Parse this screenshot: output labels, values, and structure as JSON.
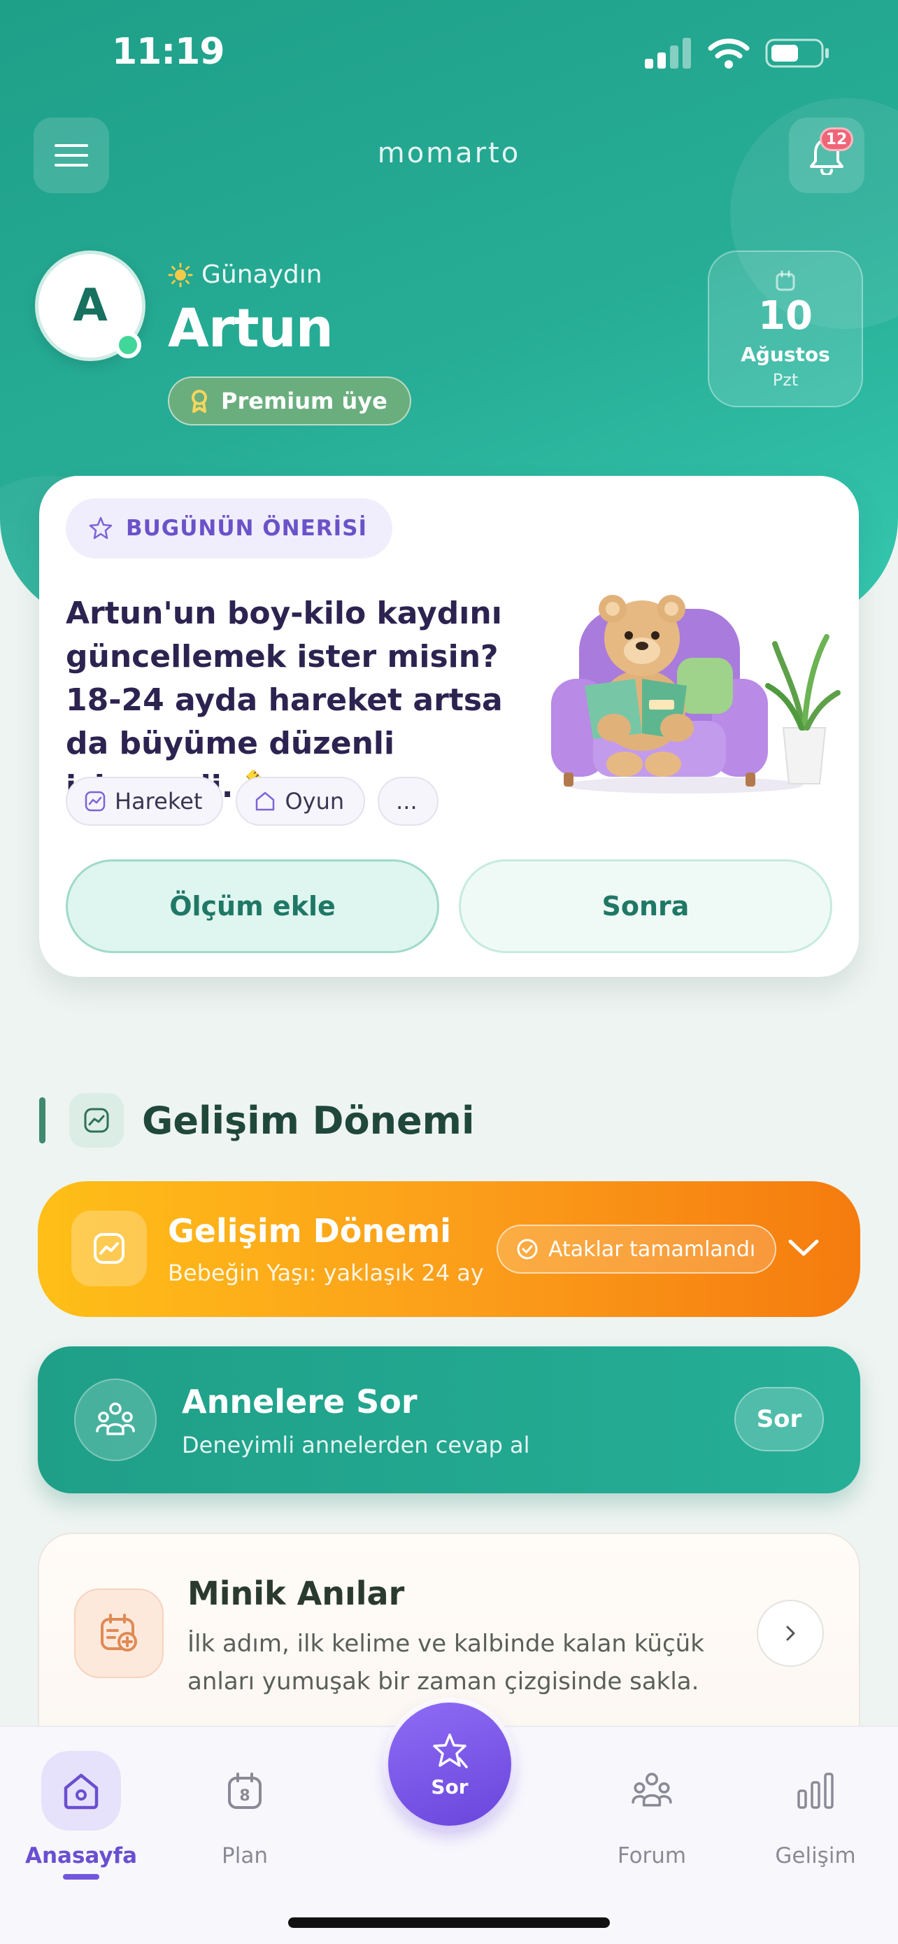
{
  "status_bar": {
    "time": "11:19"
  },
  "header": {
    "brand": "momarto",
    "notification_count": "12"
  },
  "profile": {
    "avatar_letter": "A",
    "greeting": "Günaydın",
    "name": "Artun",
    "badge": "Premium üye"
  },
  "date": {
    "day": "10",
    "month": "Ağustos",
    "weekday": "Pzt"
  },
  "recommendation": {
    "chip": "BUGÜNÜN ÖNERİSİ",
    "text": "Artun'un boy-kilo kaydını güncellemek ister misin? 18-24 ayda hareket artsa da büyüme düzenli izlenmeli. 📏",
    "tags": [
      "Hareket",
      "Oyun",
      "..."
    ],
    "primary_button": "Ölçüm ekle",
    "secondary_button": "Sonra"
  },
  "development_section": {
    "heading": "Gelişim Dönemi",
    "card_title": "Gelişim Dönemi",
    "card_subtitle": "Bebeğin Yaşı: yaklaşık 24 ay",
    "badge": "Ataklar tamamlandı"
  },
  "ask_mothers": {
    "title": "Annelere Sor",
    "subtitle": "Deneyimli annelerden cevap al",
    "button": "Sor"
  },
  "memories": {
    "title": "Minik Anılar",
    "description": "İlk adım, ilk kelime ve kalbinde kalan küçük anları yumuşak bir zaman çizgisinde sakla."
  },
  "tabbar": {
    "home": "Anasayfa",
    "plan": "Plan",
    "plan_icon_day": "8",
    "fab": "Sor",
    "forum": "Forum",
    "progress": "Gelişim"
  },
  "colors": {
    "primary_teal": "#1e9f88",
    "accent_purple": "#6a45dc",
    "orange": "#f7930f",
    "badge_red": "#f06478"
  }
}
